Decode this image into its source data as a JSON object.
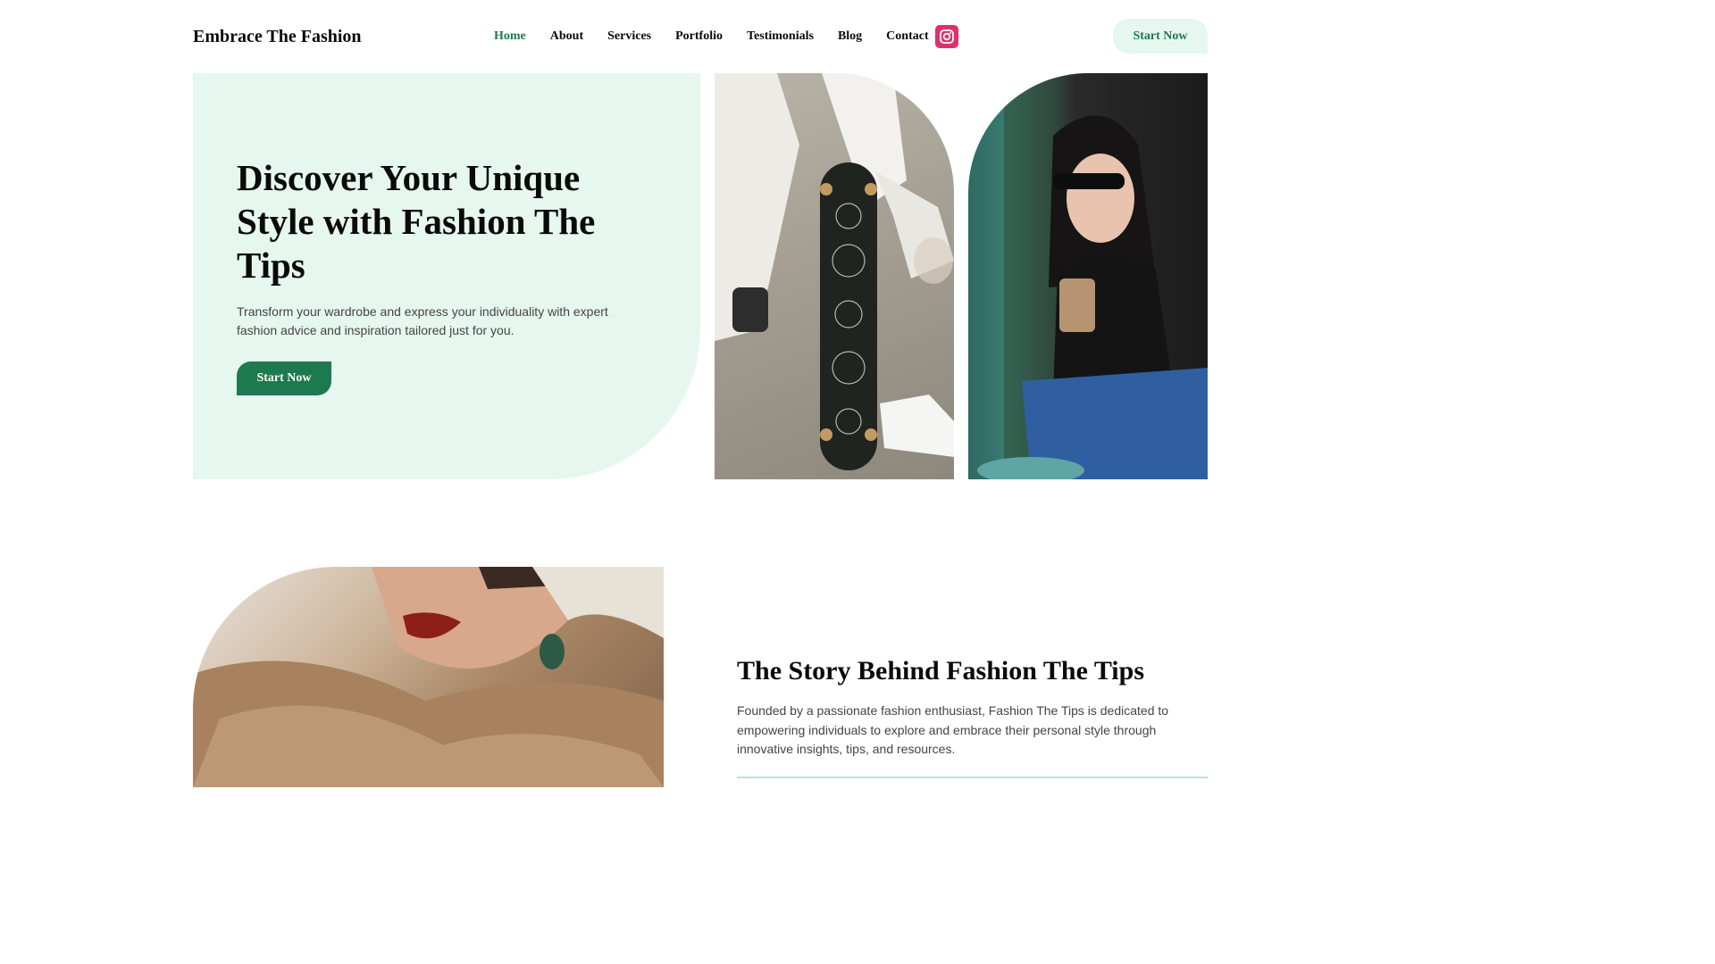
{
  "header": {
    "logo": "Embrace The Fashion",
    "nav": [
      {
        "label": "Home",
        "active": true
      },
      {
        "label": "About"
      },
      {
        "label": "Services"
      },
      {
        "label": "Portfolio"
      },
      {
        "label": "Testimonials"
      },
      {
        "label": "Blog"
      },
      {
        "label": "Contact"
      }
    ],
    "social_icon": "instagram-icon",
    "cta_label": "Start Now"
  },
  "hero": {
    "title": "Discover Your Unique Style with Fashion The Tips",
    "subtitle": "Transform your wardrobe and express your individuality with expert fashion advice and inspiration tailored just for you.",
    "cta_label": "Start Now"
  },
  "story": {
    "title": "The Story Behind Fashion The Tips",
    "text": "Founded by a passionate fashion enthusiast, Fashion The Tips is dedicated to empowering individuals to explore and embrace their personal style through innovative insights, tips, and resources."
  },
  "colors": {
    "accent": "#1d7a4f",
    "panel": "#e6f7ef",
    "instagram": "#e0306a"
  }
}
